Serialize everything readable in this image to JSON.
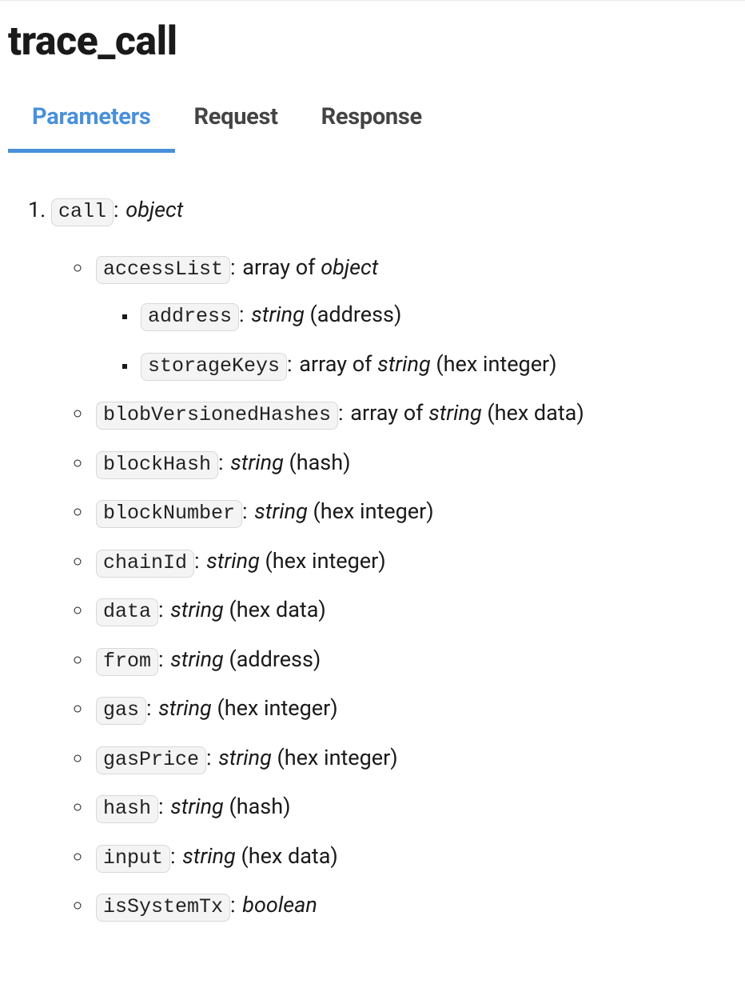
{
  "title": "trace_call",
  "tabs": [
    {
      "label": "Parameters",
      "active": true
    },
    {
      "label": "Request",
      "active": false
    },
    {
      "label": "Response",
      "active": false
    }
  ],
  "params": [
    {
      "name": "call",
      "type": "object",
      "desc": "",
      "children": [
        {
          "name": "accessList",
          "type_prefix": "array of ",
          "type": "object",
          "desc": "",
          "children": [
            {
              "name": "address",
              "type": "string",
              "desc": " (address)"
            },
            {
              "name": "storageKeys",
              "type_prefix": "array of ",
              "type": "string",
              "desc": " (hex integer)"
            }
          ]
        },
        {
          "name": "blobVersionedHashes",
          "type_prefix": "array of ",
          "type": "string",
          "desc": " (hex data)"
        },
        {
          "name": "blockHash",
          "type": "string",
          "desc": " (hash)"
        },
        {
          "name": "blockNumber",
          "type": "string",
          "desc": " (hex integer)"
        },
        {
          "name": "chainId",
          "type": "string",
          "desc": " (hex integer)"
        },
        {
          "name": "data",
          "type": "string",
          "desc": " (hex data)"
        },
        {
          "name": "from",
          "type": "string",
          "desc": " (address)"
        },
        {
          "name": "gas",
          "type": "string",
          "desc": " (hex integer)"
        },
        {
          "name": "gasPrice",
          "type": "string",
          "desc": " (hex integer)"
        },
        {
          "name": "hash",
          "type": "string",
          "desc": " (hash)"
        },
        {
          "name": "input",
          "type": "string",
          "desc": " (hex data)"
        },
        {
          "name": "isSystemTx",
          "type": "boolean",
          "desc": ""
        }
      ]
    }
  ]
}
